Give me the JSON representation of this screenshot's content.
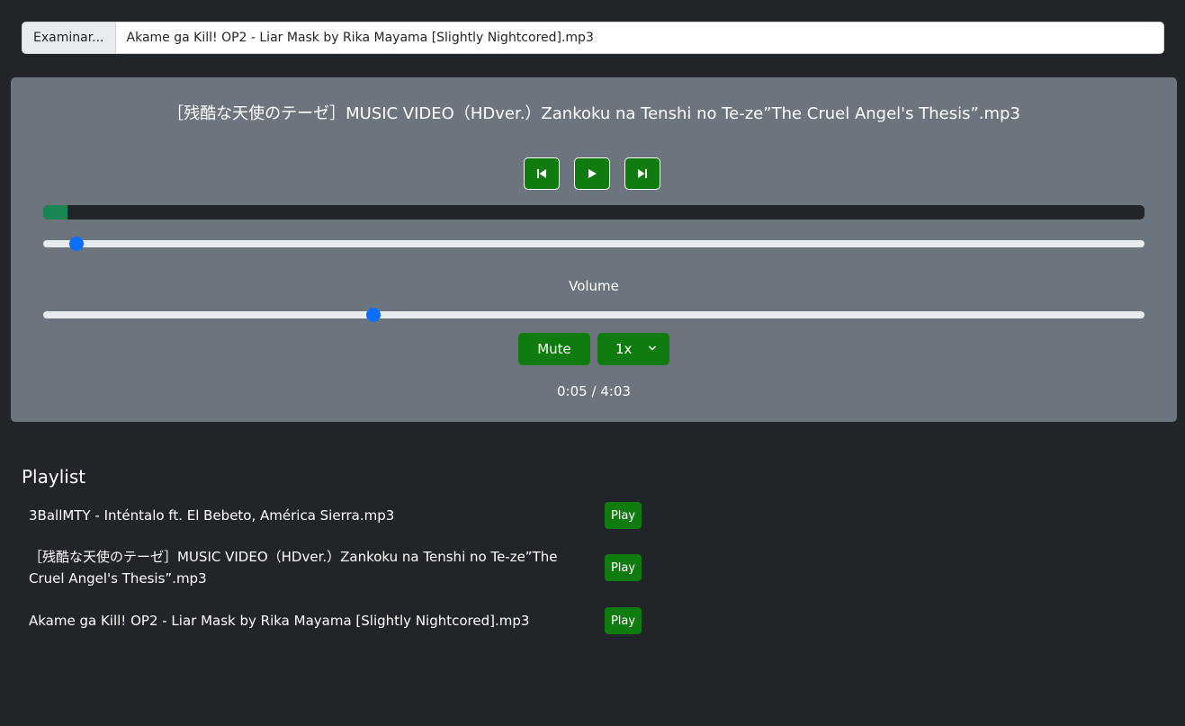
{
  "file_input": {
    "button_label": "Examinar...",
    "file_name": "Akame ga Kill! OP2 - Liar Mask by Rika Mayama [Slightly Nightcored].mp3"
  },
  "player": {
    "title": "［残酷な天使のテーゼ］MUSIC VIDEO（HDver.）Zankoku na Tenshi no Te-ze”The Cruel Angel's Thesis”.mp3",
    "controls": {
      "previous_icon": "skip-previous-icon",
      "play_icon": "play-icon",
      "next_icon": "skip-next-icon"
    },
    "progress_fraction": 0.022,
    "seek_fraction": 0.03,
    "volume_label": "Volume",
    "volume_fraction": 0.3,
    "mute_label": "Mute",
    "speed_value": "1x",
    "time_display": "0:05 / 4:03"
  },
  "playlist": {
    "title": "Playlist",
    "items": [
      {
        "name": "3BallMTY - Inténtalo ft. El Bebeto, América Sierra.mp3",
        "play_label": "Play"
      },
      {
        "name": "［残酷な天使のテーゼ］MUSIC VIDEO（HDver.）Zankoku na Tenshi no Te-ze”The Cruel Angel's Thesis”.mp3",
        "play_label": "Play"
      },
      {
        "name": "Akame ga Kill! OP2 - Liar Mask by Rika Mayama [Slightly Nightcored].mp3",
        "play_label": "Play"
      }
    ]
  },
  "colors": {
    "background": "#212529",
    "panel": "#6c757d",
    "button_green": "#107c10",
    "progress_fill": "#198754",
    "slider_thumb": "#0d6efd"
  }
}
